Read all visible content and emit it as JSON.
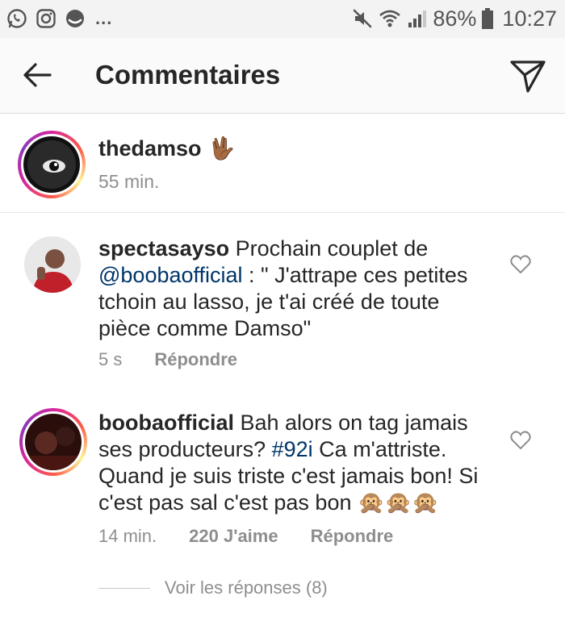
{
  "status_bar": {
    "left_icons": [
      "whatsapp-icon",
      "instagram-icon",
      "messenger-icon"
    ],
    "more": "...",
    "battery": "86%",
    "time": "10:27"
  },
  "header": {
    "title": "Commentaires"
  },
  "caption": {
    "username": "thedamso",
    "emoji": "🖖🏾",
    "time": "55 min."
  },
  "comments": [
    {
      "username": "spectasayso",
      "text_before": " Prochain couplet de ",
      "mention": "@boobaofficial",
      "text_after": " : \" J'attrape ces petites tchoin au lasso, je t'ai créé de toute pièce comme Damso\"",
      "time": "5 s",
      "reply": "Répondre"
    },
    {
      "username": "boobaofficial",
      "text_before": " Bah alors on tag jamais ses producteurs? ",
      "mention": "#92i",
      "text_after": " Ca m'attriste. Quand je suis triste c'est jamais bon! Si c'est pas sal c'est pas bon ",
      "emojis": "🙊🙊🙊",
      "time": "14 min.",
      "likes": "220 J'aime",
      "reply": "Répondre"
    }
  ],
  "view_replies": "Voir les réponses (8)",
  "colors": {
    "link": "#003569",
    "secondary_text": "#8e8e8e",
    "primary_text": "#262626"
  }
}
